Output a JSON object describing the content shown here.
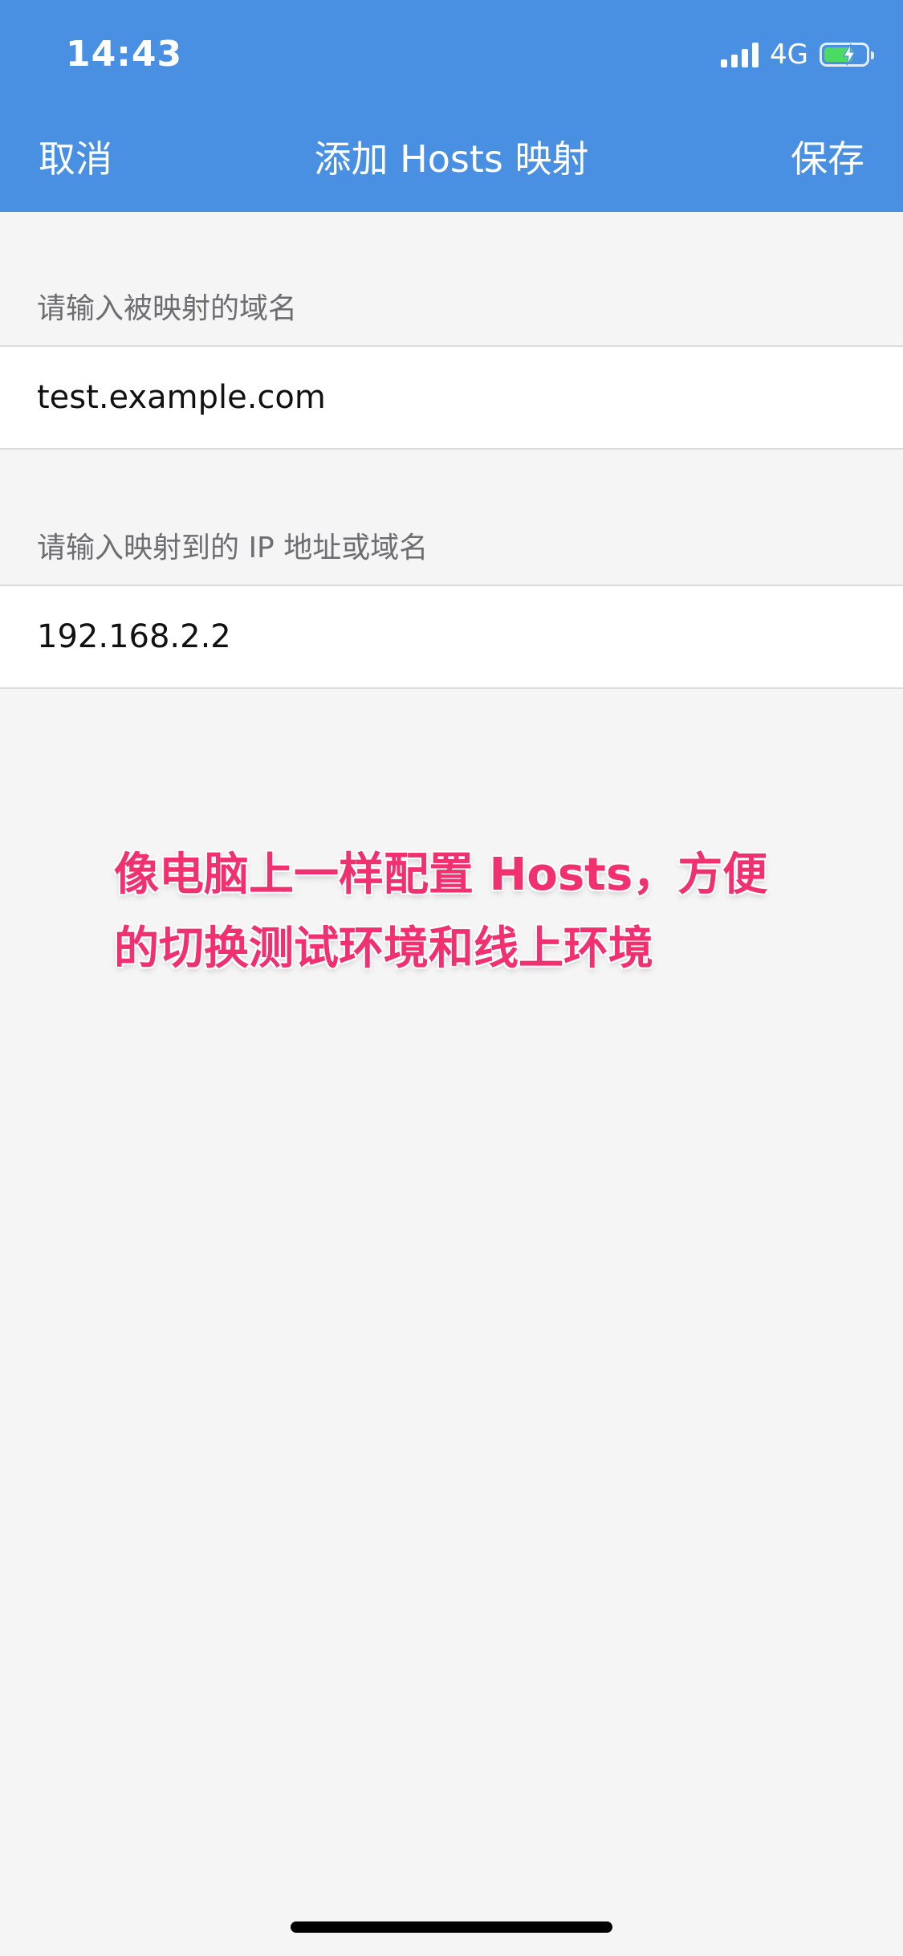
{
  "status_bar": {
    "time": "14:43",
    "network": "4G",
    "battery_level": 0.7,
    "battery_color": "#4cd964"
  },
  "nav": {
    "cancel_label": "取消",
    "title": "添加 Hosts 映射",
    "save_label": "保存",
    "background": "#4a90e2"
  },
  "form": {
    "domain_section_label": "请输入被映射的域名",
    "domain_value": "test.example.com",
    "target_section_label": "请输入映射到的 IP 地址或域名",
    "target_value": "192.168.2.2"
  },
  "annotation": {
    "line1": "像电脑上一样配置 Hosts，方便",
    "line2": "的切换测试环境和线上环境",
    "color": "#f0306f"
  }
}
